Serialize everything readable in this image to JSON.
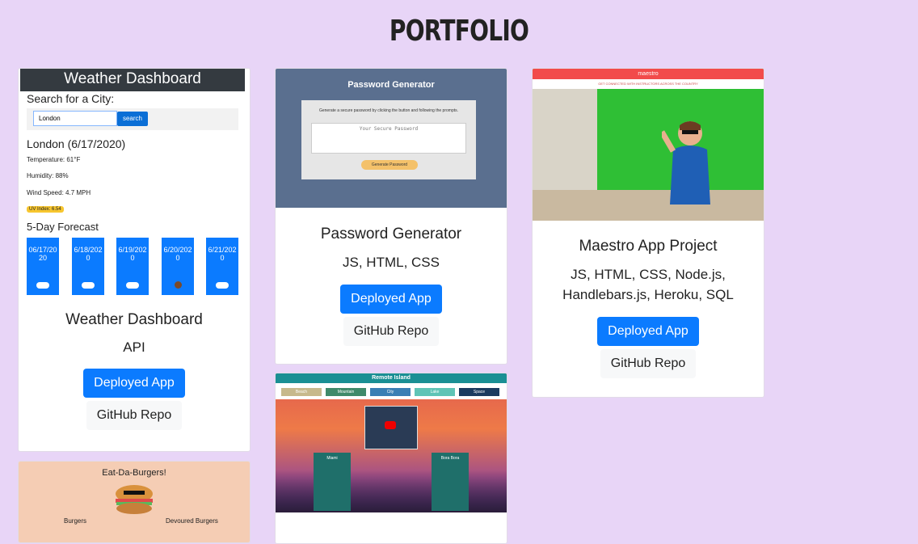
{
  "header": {
    "title": "PORTFOLIO"
  },
  "projects": [
    {
      "title": "Weather Dashboard",
      "tech": "API",
      "deployed_label": "Deployed App",
      "repo_label": "GitHub Repo",
      "screenshot": {
        "banner": "Weather Dashboard",
        "search_heading": "Search for a City:",
        "input_value": "London",
        "search_button": "search",
        "city_line": "London (6/17/2020)",
        "temperature": "Temperature: 61°F",
        "humidity": "Humidity: 88%",
        "wind": "Wind Speed: 4.7 MPH",
        "uv": "UV Index: 6.54",
        "forecast_heading": "5-Day Forecast",
        "forecast_dates": [
          "06/17/2020",
          "6/18/2020",
          "6/19/2020",
          "6/20/2020",
          "6/21/2020"
        ]
      }
    },
    {
      "title": "Password Generator",
      "tech": "JS, HTML, CSS",
      "deployed_label": "Deployed App",
      "repo_label": "GitHub Repo",
      "screenshot": {
        "heading": "Password Generator",
        "instructions": "Generate a secure password by clicking the button and following the prompts.",
        "placeholder": "Your Secure Password",
        "button": "Generate Password"
      }
    },
    {
      "title": "Maestro App Project",
      "tech": "JS, HTML, CSS, Node.js, Handlebars.js, Heroku, SQL",
      "deployed_label": "Deployed App",
      "repo_label": "GitHub Repo",
      "screenshot": {
        "brand": "maestro",
        "tagline": "GET CONNECTED WITH INSTRUCTORS ACROSS THE COUNTRY"
      }
    },
    {
      "screenshot": {
        "heading": "Remote Island",
        "tabs": [
          "Beach",
          "Mountain",
          "City",
          "Lake",
          "Space"
        ],
        "left_panel": "Miami",
        "right_panel": "Bora Bora"
      }
    },
    {
      "screenshot": {
        "heading": "Eat-Da-Burgers!",
        "left_col": "Burgers",
        "right_col": "Devoured Burgers"
      }
    }
  ]
}
